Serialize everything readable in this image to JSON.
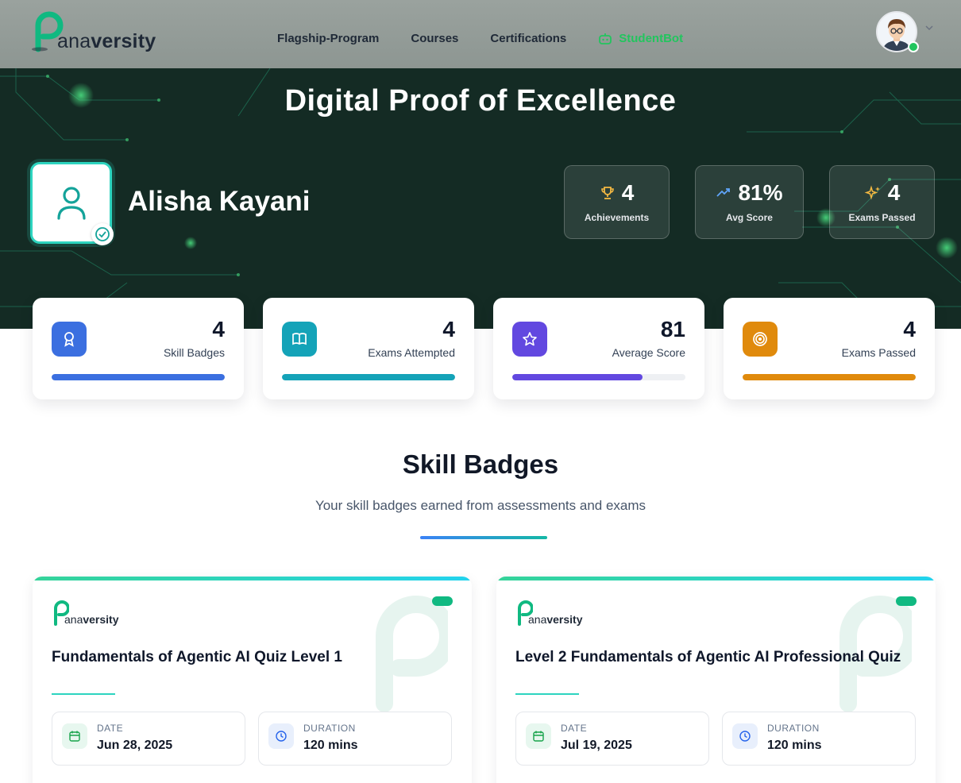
{
  "nav": {
    "logo_brand_a": "ana",
    "logo_brand_b": "versity",
    "links": [
      "Flagship-Program",
      "Courses",
      "Certifications"
    ],
    "bot_label": "StudentBot"
  },
  "hero": {
    "title": "Digital Proof of Excellence",
    "name": "Alisha Kayani",
    "stats": [
      {
        "value": "4",
        "label": "Achievements",
        "icon": "trophy-icon"
      },
      {
        "value": "81%",
        "label": "Avg Score",
        "icon": "trending-up-icon"
      },
      {
        "value": "4",
        "label": "Exams Passed",
        "icon": "sparkles-icon"
      }
    ]
  },
  "stat_cards": [
    {
      "value": "4",
      "label": "Skill Badges",
      "progress": 1.0,
      "color": "#3b6fe0",
      "icon": "award-icon"
    },
    {
      "value": "4",
      "label": "Exams Attempted",
      "progress": 1.0,
      "color": "#14a3b8",
      "icon": "book-open-icon"
    },
    {
      "value": "81",
      "label": "Average Score",
      "progress": 0.75,
      "color": "#6248e0",
      "icon": "star-icon"
    },
    {
      "value": "4",
      "label": "Exams Passed",
      "progress": 1.0,
      "color": "#e08a0c",
      "icon": "target-icon"
    }
  ],
  "section": {
    "title": "Skill Badges",
    "subtitle": "Your skill badges earned from assessments and exams"
  },
  "badges": [
    {
      "title": "Fundamentals of Agentic AI Quiz Level 1",
      "date_label": "DATE",
      "date": "Jun 28, 2025",
      "duration_label": "DURATION",
      "duration": "120 mins"
    },
    {
      "title": "Level 2 Fundamentals of Agentic AI Professional Quiz",
      "date_label": "DATE",
      "date": "Jul 19, 2025",
      "duration_label": "DURATION",
      "duration": "120 mins"
    }
  ]
}
